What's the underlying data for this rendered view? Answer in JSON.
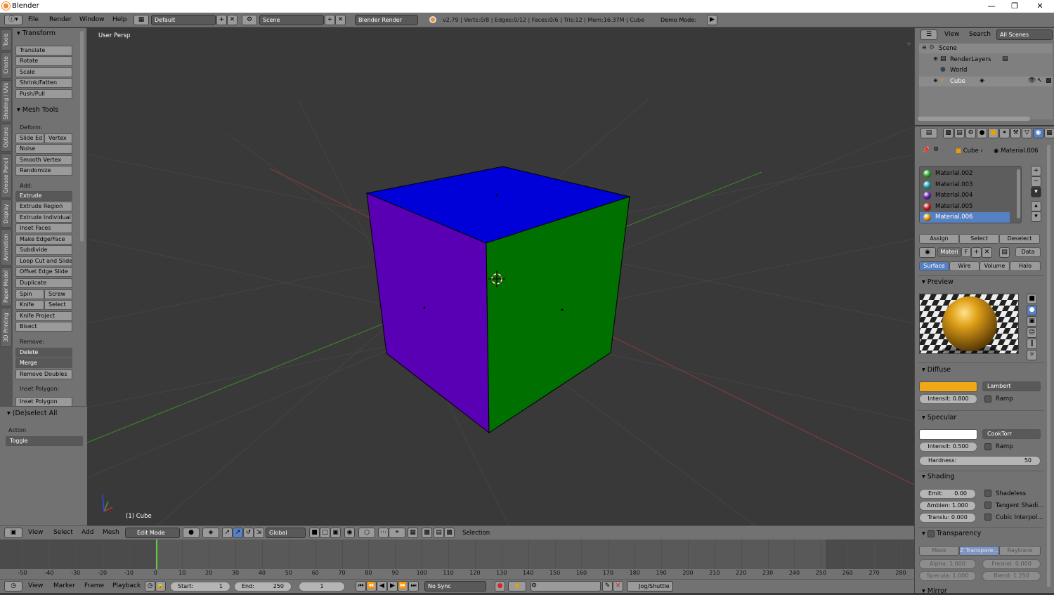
{
  "window": {
    "title": "Blender"
  },
  "menus": {
    "file": "File",
    "render": "Render",
    "window": "Window",
    "help": "Help"
  },
  "layout_name": "Default",
  "scene_name": "Scene",
  "render_engine": "Blender Render",
  "stats": "v2.79 | Verts:0/8 | Edges:0/12 | Faces:0/6 | Tris:12 | Mem:16.37M | Cube",
  "demo_mode": "Demo Mode:",
  "vtabs": [
    "Tools",
    "Create",
    "Shading / UVs",
    "Options",
    "Grease Pencil",
    "Display",
    "Animation",
    "Paper Model",
    "3D Printing"
  ],
  "transform": {
    "header": "Transform",
    "buttons": [
      "Translate",
      "Rotate",
      "Scale",
      "Shrink/Fatten",
      "Push/Pull"
    ]
  },
  "mesh_tools": {
    "header": "Mesh Tools",
    "deform_label": "Deform:",
    "slide_edge": "Slide Ed",
    "vertex": "Vertex",
    "noise": "Noise",
    "smooth_vertex": "Smooth Vertex",
    "randomize": "Randomize",
    "add_label": "Add:",
    "extrude": "Extrude",
    "extrude_region": "Extrude Region",
    "extrude_individual": "Extrude Individual",
    "inset_faces": "Inset Faces",
    "make_edge_face": "Make Edge/Face",
    "subdivide": "Subdivide",
    "loop_cut": "Loop Cut and Slide",
    "offset_edge": "Offset Edge Slide",
    "duplicate": "Duplicate",
    "spin": "Spin",
    "screw": "Screw",
    "knife": "Knife",
    "select": "Select",
    "knife_project": "Knife Project",
    "bisect": "Bisect",
    "remove_label": "Remove:",
    "delete": "Delete",
    "merge": "Merge",
    "remove_doubles": "Remove Doubles",
    "inset_polygon_label": "Inset Polygon:",
    "inset_polygon": "Inset Polygon"
  },
  "operator": {
    "header": "(De)select All",
    "action_label": "Action",
    "action_value": "Toggle"
  },
  "viewport": {
    "label": "User Persp",
    "object_label": "(1) Cube"
  },
  "view_footer": {
    "view": "View",
    "select": "Select",
    "add": "Add",
    "mesh": "Mesh",
    "mode": "Edit Mode",
    "orientation": "Global",
    "selection": "Selection"
  },
  "timeline": {
    "ticks": [
      "-50",
      "-40",
      "-30",
      "-20",
      "-10",
      "0",
      "10",
      "20",
      "30",
      "40",
      "50",
      "60",
      "70",
      "80",
      "90",
      "100",
      "110",
      "120",
      "130",
      "140",
      "150",
      "160",
      "170",
      "180",
      "190",
      "200",
      "210",
      "220",
      "230",
      "240",
      "250",
      "260",
      "270",
      "280"
    ]
  },
  "timeline_footer": {
    "view": "View",
    "marker": "Marker",
    "frame": "Frame",
    "playback": "Playback",
    "start_label": "Start:",
    "start": "1",
    "end_label": "End:",
    "end": "250",
    "current": "1",
    "sync": "No Sync",
    "jog": "Jog/Shuttle"
  },
  "outliner": {
    "view": "View",
    "search": "Search",
    "scope": "All Scenes",
    "items": [
      "Scene",
      "RenderLayers",
      "World",
      "Cube"
    ]
  },
  "properties": {
    "breadcrumb_object": "Cube",
    "breadcrumb_material": "Material.006",
    "materials": [
      {
        "name": "Material.002",
        "color": "#2fae2f"
      },
      {
        "name": "Material.003",
        "color": "#1aa6b0"
      },
      {
        "name": "Material.004",
        "color": "#6a1fb0"
      },
      {
        "name": "Material.005",
        "color": "#c81e1e"
      },
      {
        "name": "Material.006",
        "color": "#d99a10"
      }
    ],
    "assign": "Assign",
    "select": "Select",
    "deselect": "Deselect",
    "mat_name": "Materi",
    "mat_f": "F",
    "data": "Data",
    "tabs": [
      "Surface",
      "Wire",
      "Volume",
      "Halo"
    ],
    "preview": "Preview",
    "diffuse": {
      "header": "Diffuse",
      "color": "#f0a818",
      "shader": "Lambert",
      "intensity": "Intensit: 0.800",
      "ramp": "Ramp"
    },
    "specular": {
      "header": "Specular",
      "color": "#ffffff",
      "shader": "CookTorr",
      "intensity": "Intensit: 0.500",
      "ramp": "Ramp",
      "hardness_label": "Hardness:",
      "hardness": "50"
    },
    "shading": {
      "header": "Shading",
      "emit": "Emit:",
      "emit_val": "0.00",
      "ambient": "Ambien: 1.000",
      "translucency": "Translu: 0.000",
      "shadeless": "Shadeless",
      "tangent": "Tangent Shadi...",
      "cubic": "Cubic Interpol..."
    },
    "transparency": {
      "header": "Transparency",
      "mask": "Mask",
      "ztransp": "Z Transpare...",
      "raytrace": "Raytrace",
      "alpha": "Alpha:   1.000",
      "fresnel": "Fresnel:  0.000",
      "specular": "Specula: 1.000",
      "blend": "Blend:    1.250"
    },
    "mirror": "Mirror"
  },
  "colors": {
    "top_face": "#0000d8",
    "left_face": "#5a00b4",
    "right_face": "#007000",
    "accent": "#5680c2"
  }
}
